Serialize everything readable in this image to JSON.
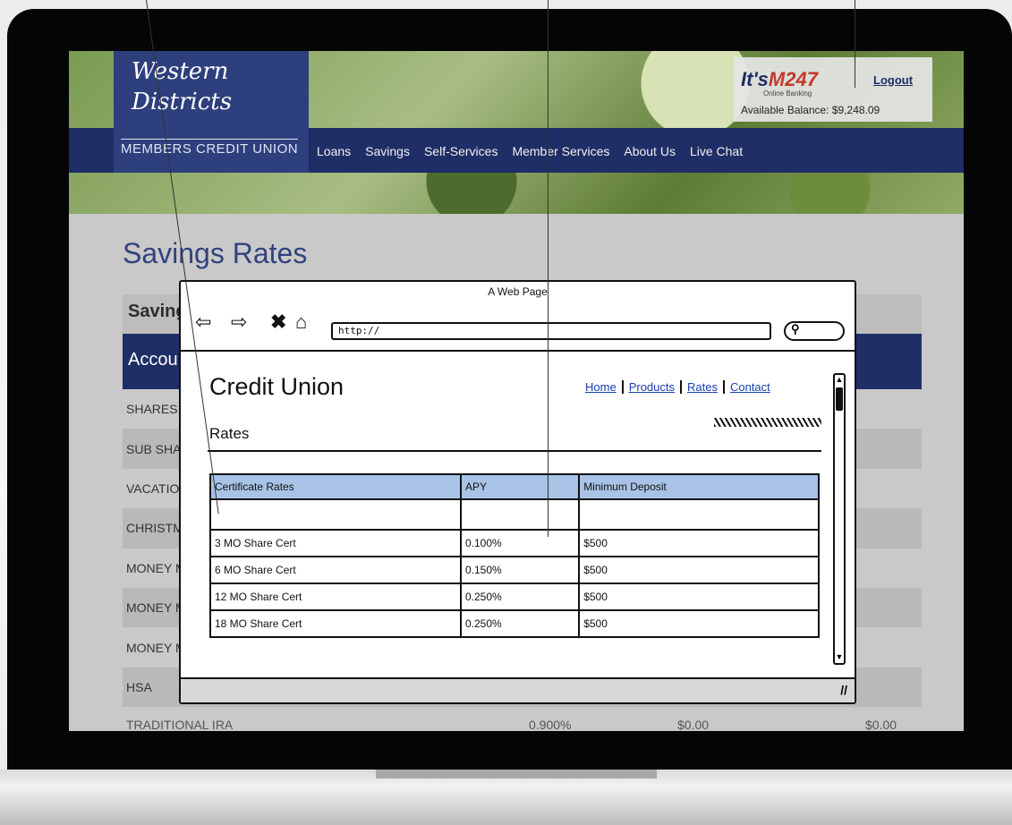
{
  "credit_union_site": {
    "logo_script": "Western Districts",
    "logo_sub": "MEMBERS CREDIT UNION",
    "nav": [
      "Loans",
      "Savings",
      "Self-Services",
      "Member Services",
      "About Us",
      "Live Chat"
    ],
    "brand_logo_main": "It's",
    "brand_logo_accent": "M247",
    "brand_tag": "Online Banking",
    "logout": "Logout",
    "balance": "Available Balance: $9,248.09",
    "page_title": "Savings Rates",
    "section_label": "Saving",
    "account_header": "Accou",
    "rows": [
      "SHARES",
      "SUB SHA",
      "VACATIO",
      "CHRISTM",
      "MONEY M",
      "MONEY M",
      "MONEY M",
      "HSA"
    ],
    "ira_row": {
      "name": "TRADITIONAL IRA",
      "rate": "0.900%",
      "min": "$0.00",
      "other": "$0.00"
    }
  },
  "wireframe": {
    "window_title": "A Web Page",
    "url": "http://",
    "brand": "Credit Union",
    "links": [
      "Home",
      "Products",
      "Rates",
      "Contact"
    ],
    "section_title": "Rates",
    "table": {
      "headers": [
        "Certificate Rates",
        "APY",
        "Minimum Deposit"
      ],
      "rows": [
        [
          "",
          "",
          ""
        ],
        [
          "3 MO Share Cert",
          "0.100%",
          "$500"
        ],
        [
          "6 MO Share Cert",
          "0.150%",
          "$500"
        ],
        [
          "12 MO Share Cert",
          "0.250%",
          "$500"
        ],
        [
          "18 MO Share Cert",
          "0.250%",
          "$500"
        ]
      ]
    }
  }
}
